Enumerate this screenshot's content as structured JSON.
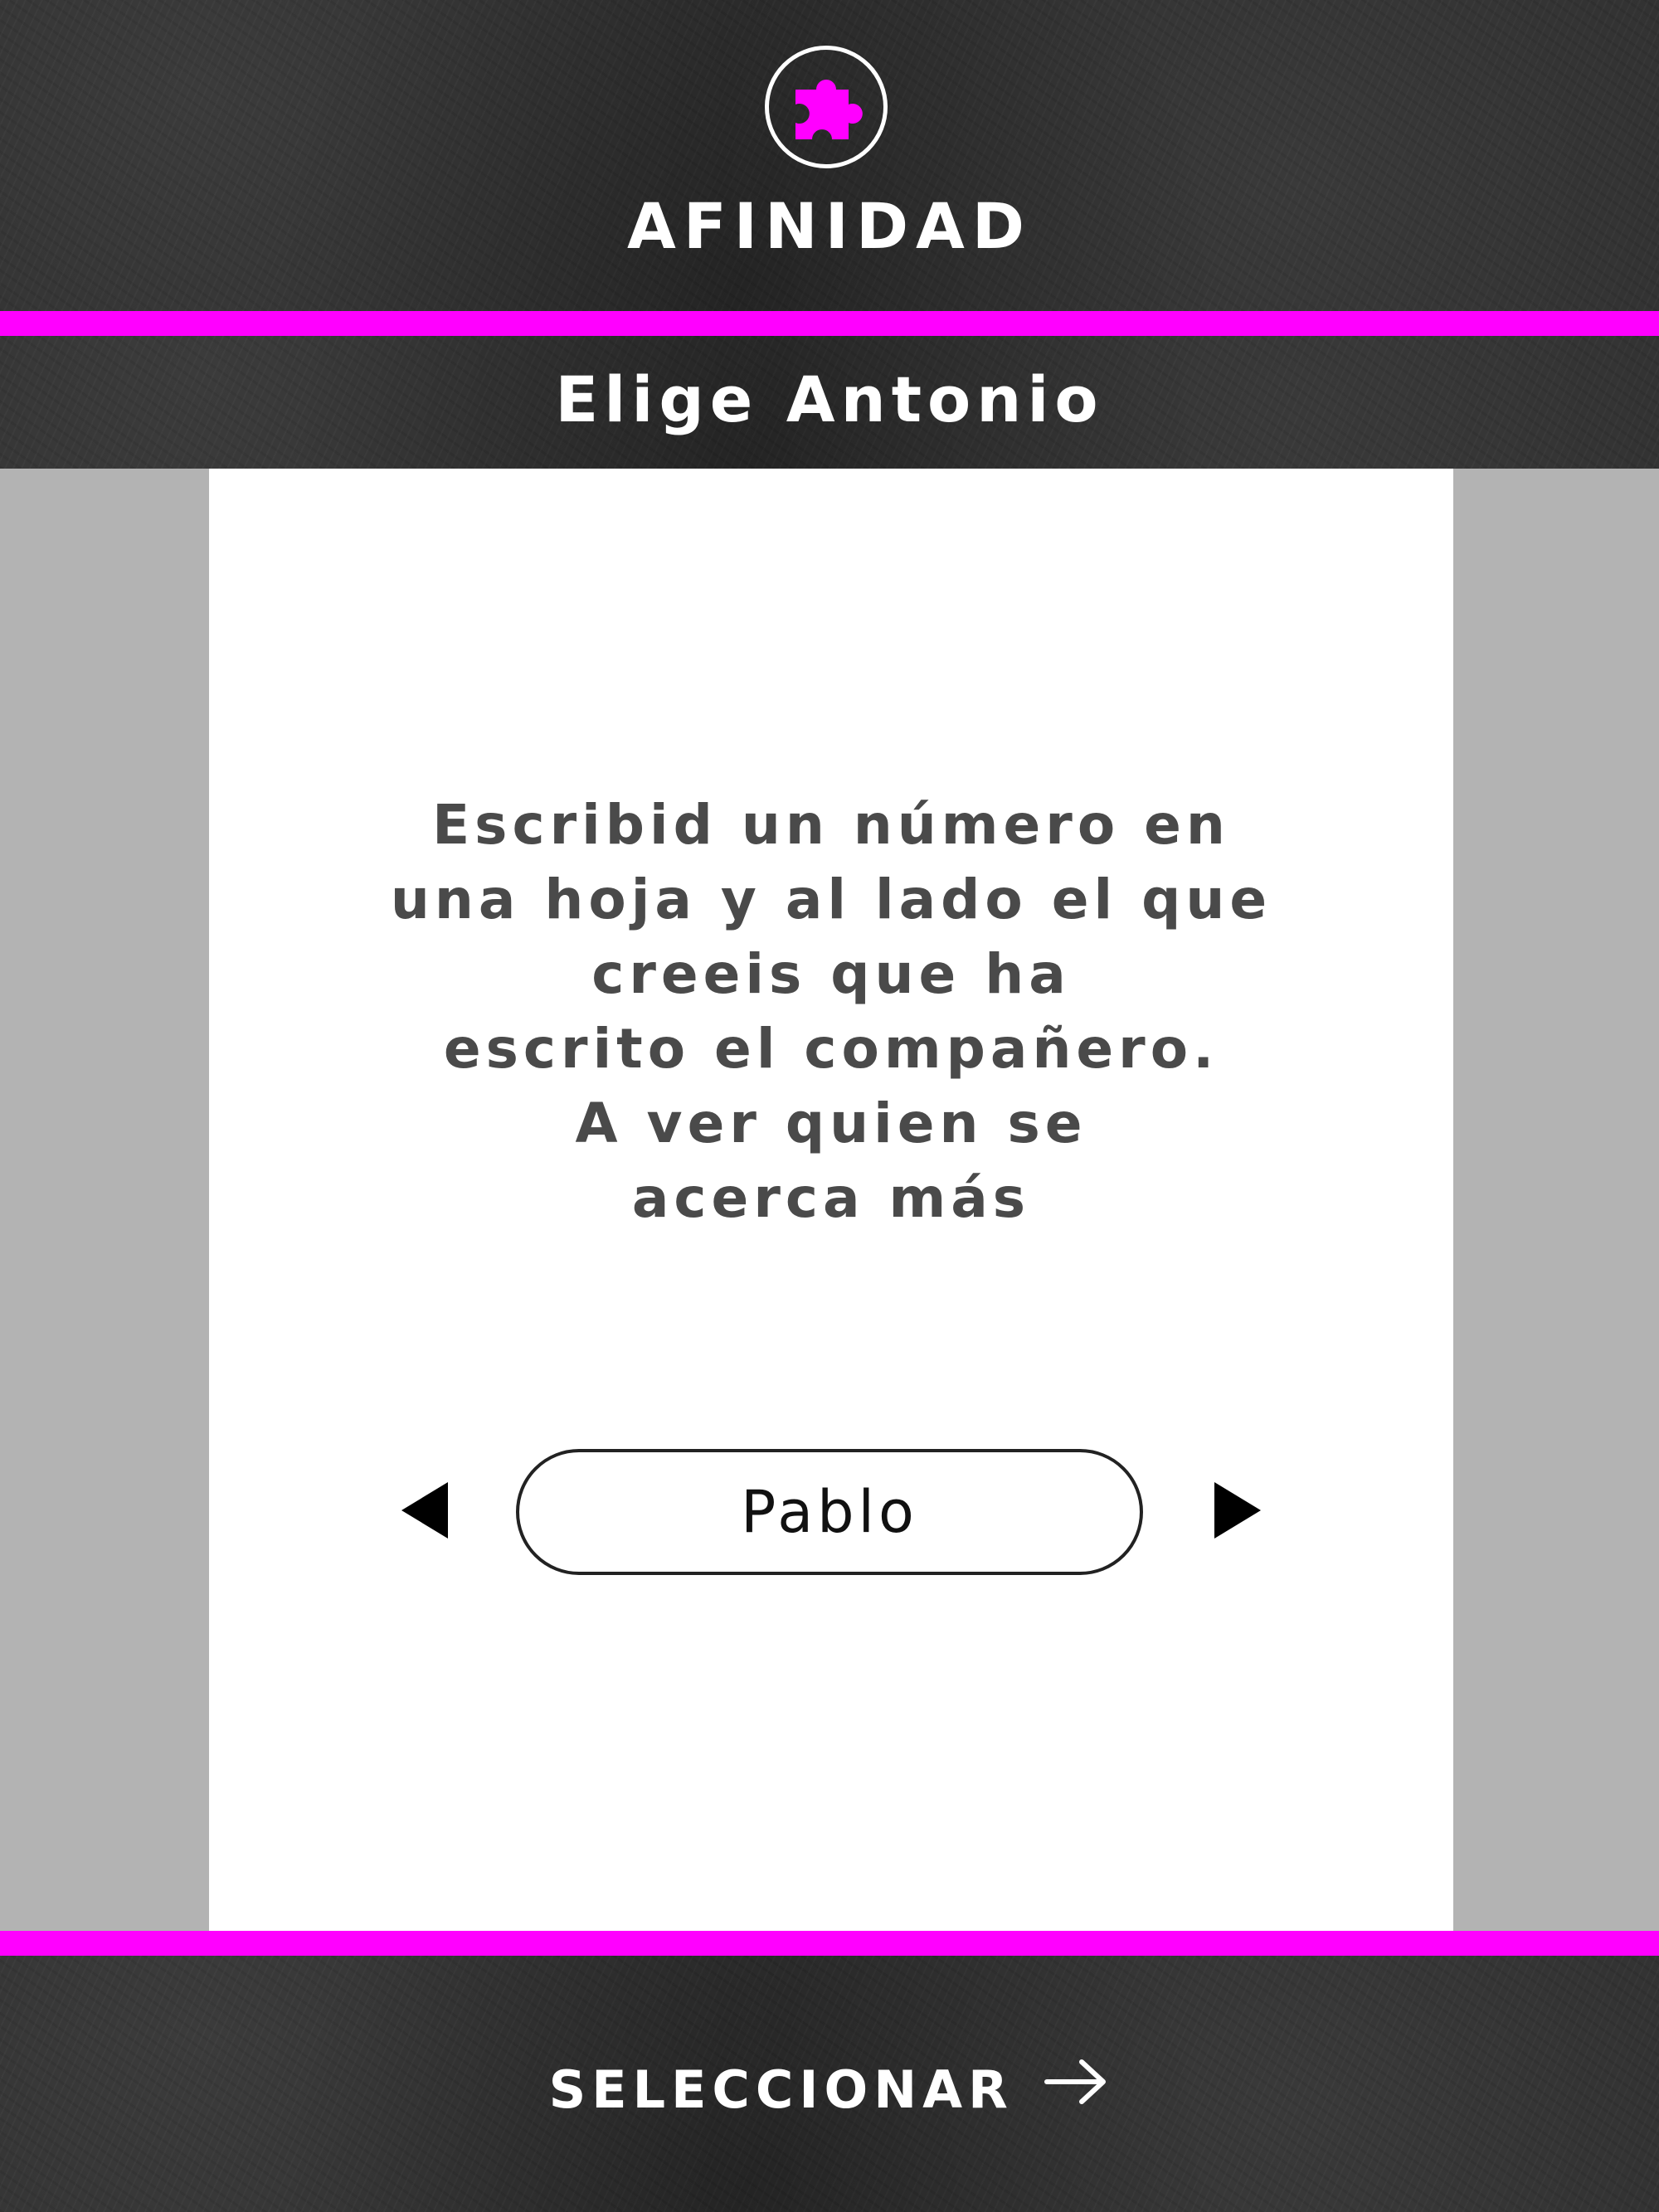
{
  "header": {
    "title": "AFINIDAD",
    "icon": "puzzle-piece-icon"
  },
  "subtitle": "Elige Antonio",
  "card": {
    "prompt": "Escribid un número en\nuna hoja y al lado el que\ncreeis que ha\nescrito el compañero.\nA ver quien se\nacerca más",
    "selector": {
      "prev_icon": "triangle-left-icon",
      "next_icon": "triangle-right-icon",
      "selected_name": "Pablo"
    }
  },
  "footer": {
    "select_label": "SELECCIONAR",
    "select_icon": "arrow-right-icon"
  },
  "colors": {
    "accent": "#ff00ff",
    "chalkboard": "#2f2f2f",
    "side_gray": "#b3b3b3",
    "card": "#ffffff",
    "prompt_text": "#4a4a4a"
  }
}
